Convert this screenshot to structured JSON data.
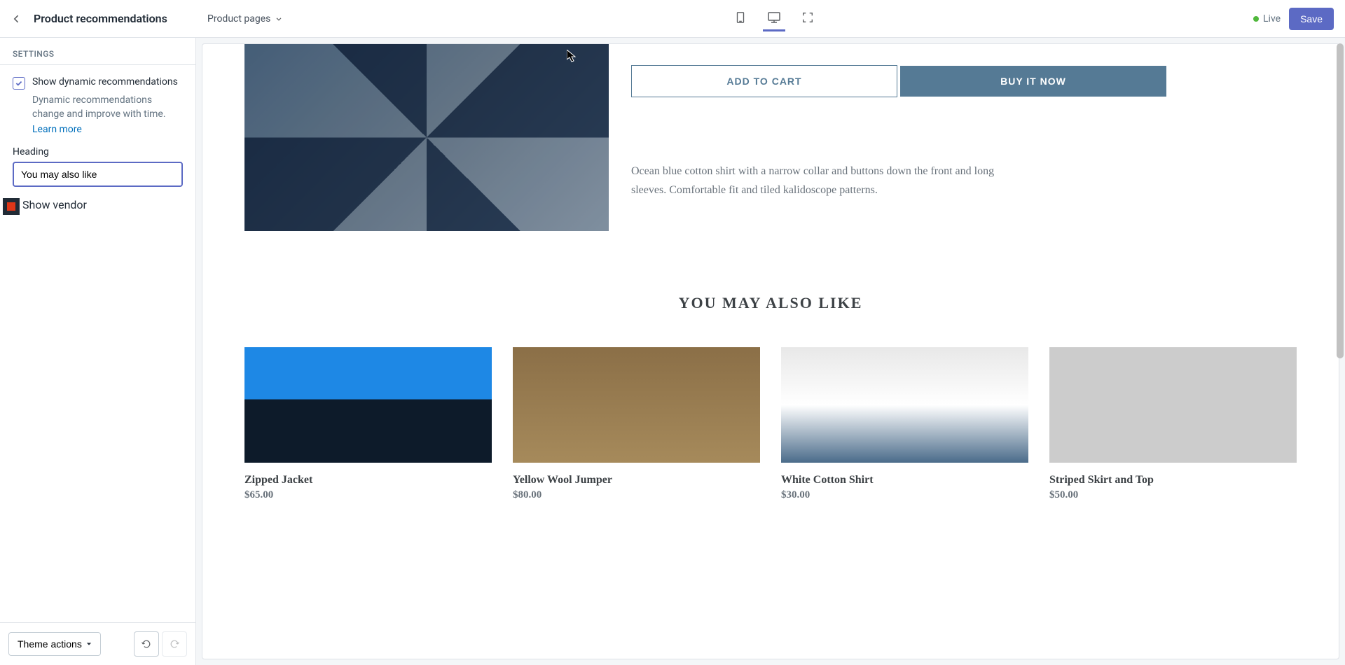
{
  "topbar": {
    "title": "Product recommendations",
    "template_label": "Product pages",
    "live_label": "Live",
    "save_label": "Save"
  },
  "sidebar": {
    "section_header": "SETTINGS",
    "dynamic": {
      "label": "Show dynamic recommendations",
      "desc": "Dynamic recommendations change and improve with time.",
      "learn_more": "Learn more",
      "checked": true
    },
    "heading_label": "Heading",
    "heading_value": "You may also like",
    "show_vendor_label": "Show vendor",
    "theme_actions_label": "Theme actions"
  },
  "preview": {
    "add_to_cart": "ADD TO CART",
    "buy_now": "BUY IT NOW",
    "description": "Ocean blue cotton shirt with a narrow collar and buttons down the front and long sleeves. Comfortable fit and tiled kalidoscope patterns.",
    "recs_heading": "YOU MAY ALSO LIKE",
    "recs": [
      {
        "title": "Zipped Jacket",
        "price": "$65.00"
      },
      {
        "title": "Yellow Wool Jumper",
        "price": "$80.00"
      },
      {
        "title": "White Cotton Shirt",
        "price": "$30.00"
      },
      {
        "title": "Striped Skirt and Top",
        "price": "$50.00"
      }
    ]
  }
}
